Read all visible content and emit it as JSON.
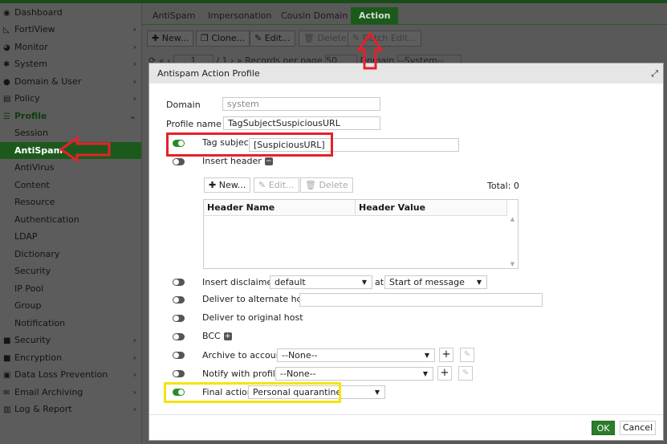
{
  "sidebar": {
    "items": [
      {
        "label": "Dashboard",
        "icon": "dashboard-icon",
        "chevron": false
      },
      {
        "label": "FortiView",
        "icon": "chart-icon",
        "chevron": true
      },
      {
        "label": "Monitor",
        "icon": "pie-icon",
        "chevron": true
      },
      {
        "label": "System",
        "icon": "gear-icon",
        "chevron": true
      },
      {
        "label": "Domain & User",
        "icon": "user-icon",
        "chevron": true
      },
      {
        "label": "Policy",
        "icon": "policy-icon",
        "chevron": true
      },
      {
        "label": "Profile",
        "icon": "list-icon",
        "chevron": true
      }
    ],
    "profile_children": [
      "Session",
      "AntiSpam",
      "AntiVirus",
      "Content",
      "Resource",
      "Authentication",
      "LDAP",
      "Dictionary",
      "Security",
      "IP Pool",
      "Group",
      "Notification"
    ],
    "bottom_items": [
      {
        "label": "Security",
        "icon": "lock-icon"
      },
      {
        "label": "Encryption",
        "icon": "lock-icon"
      },
      {
        "label": "Data Loss Prevention",
        "icon": "dlp-icon"
      },
      {
        "label": "Email Archiving",
        "icon": "mail-icon"
      },
      {
        "label": "Log & Report",
        "icon": "report-icon"
      }
    ]
  },
  "tabs": [
    "AntiSpam",
    "Impersonation",
    "Cousin Domain",
    "Action"
  ],
  "toolbar": {
    "new": "New...",
    "clone": "Clone...",
    "edit": "Edit...",
    "delete": "Delete",
    "batch_edit": "Batch Edit..."
  },
  "pager": {
    "page": "1",
    "total_pages": "/ 1",
    "records_label": "Records per page",
    "records_value": "50",
    "domain_label": "Domain",
    "domain_value": "--System--"
  },
  "modal": {
    "title": "Antispam Action Profile",
    "domain_label": "Domain",
    "domain_value": "system",
    "profile_name_label": "Profile name",
    "profile_name_value": "TagSubjectSuspiciousURL",
    "tag_subject_label": "Tag subject",
    "tag_subject_value": "[SuspiciousURL]",
    "tag_subject_enabled": true,
    "insert_header_label": "Insert header",
    "insert_header_enabled": false,
    "header_toolbar": {
      "new": "New...",
      "edit": "Edit...",
      "delete": "Delete",
      "total": "Total: 0"
    },
    "header_columns": [
      "Header Name",
      "Header Value"
    ],
    "insert_disclaimer_label": "Insert disclaimer",
    "insert_disclaimer_value": "default",
    "at_label": "at",
    "disclaimer_position": "Start of message",
    "deliver_alt_label": "Deliver to alternate host",
    "deliver_alt_value": "",
    "deliver_orig_label": "Deliver to original host",
    "bcc_label": "BCC",
    "archive_label": "Archive to account",
    "archive_value": "--None--",
    "notify_label": "Notify with profile",
    "notify_value": "--None--",
    "final_action_label": "Final action",
    "final_action_value": "Personal quarantine",
    "final_action_enabled": true,
    "ok": "OK",
    "cancel": "Cancel"
  },
  "colors": {
    "accent": "#2a7d2a",
    "highlight_red": "#e8202a",
    "highlight_yellow": "#f5e50a"
  }
}
